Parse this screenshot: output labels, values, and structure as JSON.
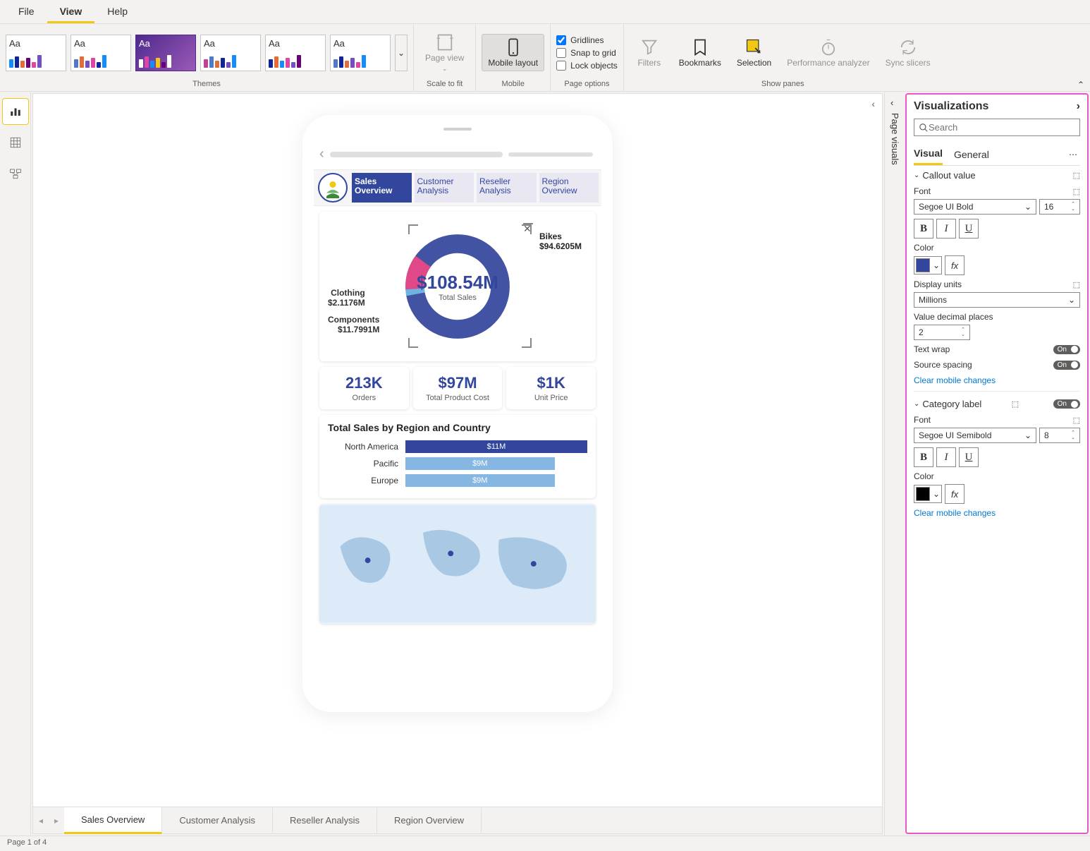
{
  "menu": {
    "file": "File",
    "view": "View",
    "help": "Help"
  },
  "ribbon": {
    "themes_label": "Themes",
    "scale_label": "Scale to fit",
    "page_view": "Page view",
    "mobile_label": "Mobile",
    "mobile_layout": "Mobile layout",
    "page_options_label": "Page options",
    "gridlines": "Gridlines",
    "snap": "Snap to grid",
    "lock": "Lock objects",
    "show_panes_label": "Show panes",
    "filters": "Filters",
    "bookmarks": "Bookmarks",
    "selection": "Selection",
    "perf": "Performance analyzer",
    "sync": "Sync slicers"
  },
  "collapsed_pane": "Page visuals",
  "phone": {
    "tabs": [
      "Sales Overview",
      "Customer Analysis",
      "Reseller Analysis",
      "Region Overview"
    ],
    "donut": {
      "center_val": "$108.54M",
      "center_lbl": "Total Sales",
      "bikes": "Bikes",
      "bikes_val": "$94.6205M",
      "clothing": "Clothing",
      "clothing_val": "$2.1176M",
      "components": "Components",
      "components_val": "$11.7991M"
    },
    "kpis": [
      {
        "val": "213K",
        "lbl": "Orders"
      },
      {
        "val": "$97M",
        "lbl": "Total Product Cost"
      },
      {
        "val": "$1K",
        "lbl": "Unit Price"
      }
    ],
    "bar_title": "Total Sales by Region and Country",
    "bars": [
      {
        "cat": "North America",
        "val": "$11M",
        "pct": 100,
        "color": "#32469e"
      },
      {
        "cat": "Pacific",
        "val": "$9M",
        "pct": 82,
        "color": "#86b6e2"
      },
      {
        "cat": "Europe",
        "val": "$9M",
        "pct": 82,
        "color": "#86b6e2"
      }
    ]
  },
  "chart_data": [
    {
      "type": "pie",
      "title": "Total Sales",
      "total": 108.54,
      "unit": "$M",
      "slices": [
        {
          "name": "Bikes",
          "value": 94.6205
        },
        {
          "name": "Components",
          "value": 11.7991
        },
        {
          "name": "Clothing",
          "value": 2.1176
        }
      ]
    },
    {
      "type": "bar",
      "title": "Total Sales by Region and Country",
      "unit": "$M",
      "categories": [
        "North America",
        "Pacific",
        "Europe"
      ],
      "values": [
        11,
        9,
        9
      ]
    }
  ],
  "page_tabs": [
    "Sales Overview",
    "Customer Analysis",
    "Reseller Analysis",
    "Region Overview"
  ],
  "status": "Page 1 of 4",
  "vis": {
    "title": "Visualizations",
    "search_ph": "Search",
    "tab_visual": "Visual",
    "tab_general": "General",
    "sec_callout": "Callout value",
    "font_lbl": "Font",
    "font1": "Segoe UI Bold",
    "size1": "16",
    "color_lbl": "Color",
    "color1": "#32469e",
    "display_units_lbl": "Display units",
    "display_units": "Millions",
    "decimals_lbl": "Value decimal places",
    "decimals": "2",
    "textwrap_lbl": "Text wrap",
    "spacing_lbl": "Source spacing",
    "clear": "Clear mobile changes",
    "sec_category": "Category label",
    "font2": "Segoe UI Semibold",
    "size2": "8",
    "color2": "#000000",
    "on": "On"
  }
}
